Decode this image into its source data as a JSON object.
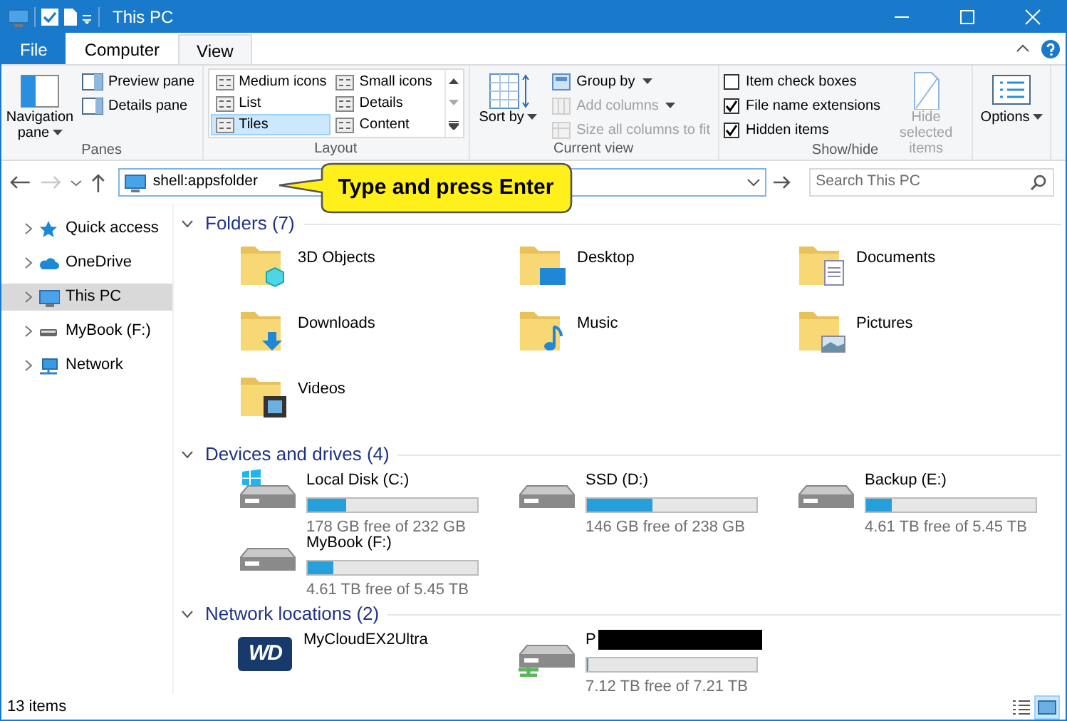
{
  "window": {
    "title": "This PC"
  },
  "ribbon_tabs": [
    {
      "label": "File",
      "kind": "file",
      "selected": false
    },
    {
      "label": "Computer",
      "kind": "tab",
      "selected": false
    },
    {
      "label": "View",
      "kind": "tab",
      "selected": true
    }
  ],
  "ribbon": {
    "groups": [
      {
        "label": "Panes",
        "columns": [
          [
            {
              "kind": "large",
              "label": "Navigation pane",
              "dropdown": true,
              "disabled": false
            }
          ],
          [
            {
              "kind": "small",
              "label": "Preview pane",
              "dropdown": false,
              "disabled": false
            },
            {
              "kind": "small",
              "label": "Details pane",
              "dropdown": false,
              "disabled": false
            }
          ]
        ]
      },
      {
        "label": "Layout",
        "columns": [
          [
            {
              "kind": "gallery",
              "options": [
                {
                  "label": "Medium icons",
                  "selected": false
                },
                {
                  "label": "Small icons",
                  "selected": false
                },
                {
                  "label": "List",
                  "selected": false
                },
                {
                  "label": "Details",
                  "selected": false
                },
                {
                  "label": "Tiles",
                  "selected": true
                },
                {
                  "label": "Content",
                  "selected": false
                }
              ]
            }
          ]
        ]
      },
      {
        "label": "Current view",
        "columns": [
          [
            {
              "kind": "large",
              "label": "Sort by",
              "dropdown": true,
              "disabled": false
            }
          ],
          [
            {
              "kind": "small",
              "label": "Group by",
              "dropdown": true,
              "disabled": false
            },
            {
              "kind": "small",
              "label": "Add columns",
              "dropdown": true,
              "disabled": true
            },
            {
              "kind": "small",
              "label": "Size all columns to fit",
              "dropdown": false,
              "disabled": true
            }
          ]
        ]
      },
      {
        "label": "Show/hide",
        "columns": [
          [
            {
              "kind": "check",
              "label": "Item check boxes",
              "checked": false
            },
            {
              "kind": "check",
              "label": "File name extensions",
              "checked": true
            },
            {
              "kind": "check",
              "label": "Hidden items",
              "checked": true
            }
          ],
          [
            {
              "kind": "large",
              "label": "Hide selected items",
              "dropdown": false,
              "disabled": true
            }
          ]
        ]
      },
      {
        "columns": [
          [
            {
              "kind": "large",
              "label": "Options",
              "dropdown": true,
              "disabled": false
            }
          ]
        ]
      }
    ]
  },
  "address_bar": {
    "value": "shell:appsfolder"
  },
  "search": {
    "placeholder": "Search This PC"
  },
  "callout": {
    "text": "Type and press Enter"
  },
  "nav_pane": [
    {
      "label": "Quick access",
      "selected": false
    },
    {
      "label": "OneDrive",
      "selected": false
    },
    {
      "label": "This PC",
      "selected": true
    },
    {
      "label": "MyBook (F:)",
      "selected": false
    },
    {
      "label": "Network",
      "selected": false
    }
  ],
  "sections": [
    {
      "heading": "Folders (7)",
      "expanded": true,
      "items": [
        {
          "kind": "folder",
          "name": "3D Objects"
        },
        {
          "kind": "folder",
          "name": "Desktop"
        },
        {
          "kind": "folder",
          "name": "Documents"
        },
        {
          "kind": "folder",
          "name": "Downloads"
        },
        {
          "kind": "folder",
          "name": "Music"
        },
        {
          "kind": "folder",
          "name": "Pictures"
        },
        {
          "kind": "folder",
          "name": "Videos"
        }
      ]
    },
    {
      "heading": "Devices and drives (4)",
      "expanded": true,
      "items": [
        {
          "kind": "system_drive",
          "name": "Local Disk (C:)",
          "level": 0.23,
          "free": "178 GB free of 232 GB"
        },
        {
          "kind": "drive",
          "name": "SSD (D:)",
          "level": 0.39,
          "free": "146 GB free of 238 GB"
        },
        {
          "kind": "drive",
          "name": "Backup (E:)",
          "level": 0.15,
          "free": "4.61 TB free of 5.45 TB"
        },
        {
          "kind": "drive",
          "name": "MyBook (F:)",
          "level": 0.15,
          "free": "4.61 TB free of 5.45 TB"
        }
      ]
    },
    {
      "heading": "Network locations (2)",
      "expanded": true,
      "items": [
        {
          "kind": "device",
          "name": "MyCloudEX2Ultra",
          "logo": "WD"
        },
        {
          "kind": "network_drive",
          "name": "P",
          "redacted": true,
          "level": 0.01,
          "free": "7.12 TB free of 7.21 TB"
        }
      ]
    }
  ],
  "status_bar": {
    "text": "13 items",
    "view_buttons": [
      {
        "selected": false
      },
      {
        "selected": true
      }
    ]
  }
}
